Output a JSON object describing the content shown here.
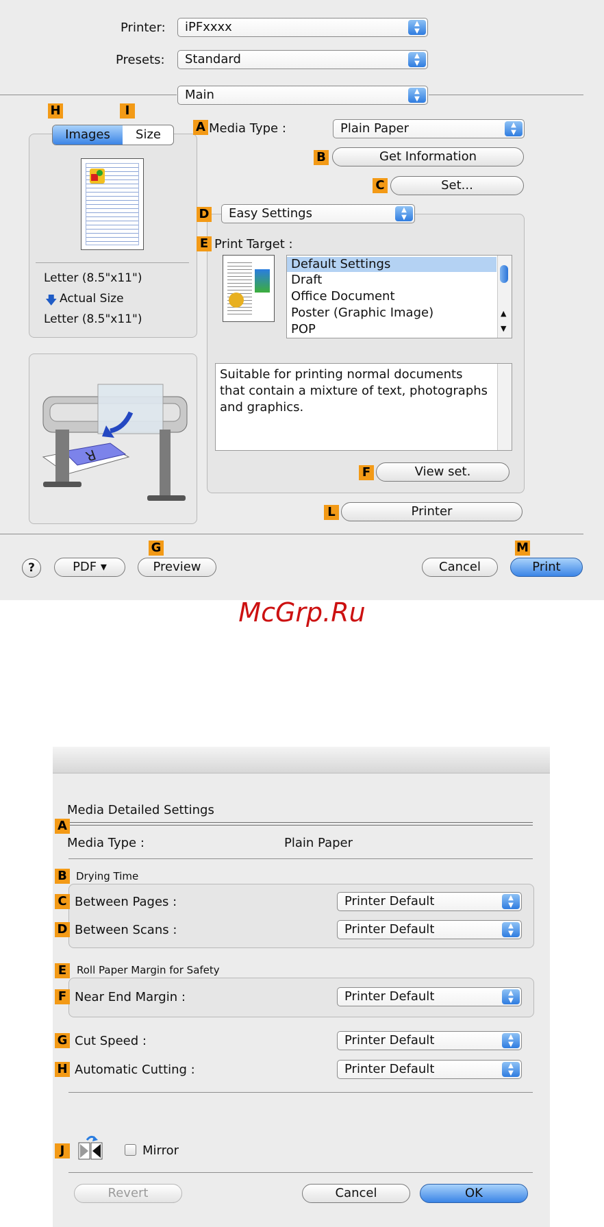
{
  "print_dialog": {
    "printer_label": "Printer:",
    "printer_value": "iPFxxxx",
    "presets_label": "Presets:",
    "presets_value": "Standard",
    "panel_value": "Main",
    "tab_images": "Images",
    "tab_size": "Size",
    "size_from": "Letter (8.5\"x11\")",
    "size_mode": "Actual Size",
    "size_to": "Letter (8.5\"x11\")",
    "media_type_label": "Media Type :",
    "media_type_value": "Plain Paper",
    "get_information": "Get Information",
    "set": "Set...",
    "easy_settings": "Easy Settings",
    "print_target_label": "Print Target :",
    "print_targets": [
      "Default Settings",
      "Draft",
      "Office Document",
      "Poster (Graphic Image)",
      "POP"
    ],
    "description": "Suitable for printing normal documents that contain a mixture of text, photographs and graphics.",
    "view_set": "View set.",
    "printer_button": "Printer",
    "help": "?",
    "pdf": "PDF ▾",
    "preview": "Preview",
    "cancel": "Cancel",
    "print": "Print"
  },
  "callouts": {
    "A": "A",
    "B": "B",
    "C": "C",
    "D": "D",
    "E": "E",
    "F": "F",
    "G": "G",
    "H": "H",
    "I": "I",
    "J": "J",
    "L": "L",
    "M": "M"
  },
  "watermark": "McGrp.Ru",
  "media_dialog": {
    "title": "Media Detailed Settings",
    "media_type_label": "Media Type :",
    "media_type_value": "Plain Paper",
    "drying_time": "Drying Time",
    "between_pages_label": "Between Pages :",
    "between_pages_value": "Printer Default",
    "between_scans_label": "Between Scans :",
    "between_scans_value": "Printer Default",
    "roll_margin": "Roll Paper Margin for Safety",
    "near_end_label": "Near End Margin :",
    "near_end_value": "Printer Default",
    "cut_speed_label": "Cut Speed :",
    "cut_speed_value": "Printer Default",
    "auto_cut_label": "Automatic Cutting :",
    "auto_cut_value": "Printer Default",
    "mirror": "Mirror",
    "revert": "Revert",
    "cancel": "Cancel",
    "ok": "OK"
  }
}
